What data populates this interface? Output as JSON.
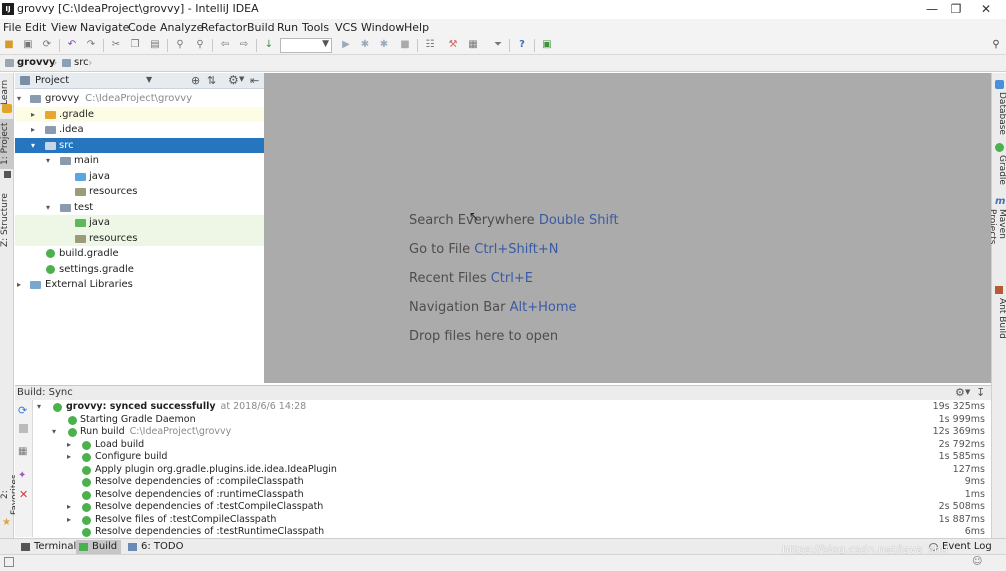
{
  "window": {
    "title": "grovvy [C:\\IdeaProject\\grovvy] - IntelliJ IDEA",
    "app_icon": "IJ",
    "controls": [
      "minimize-icon",
      "maximize-icon",
      "close-icon"
    ]
  },
  "menu": [
    "File",
    "Edit",
    "View",
    "Navigate",
    "Code",
    "Analyze",
    "Refactor",
    "Build",
    "Run",
    "Tools",
    "VCS",
    "Window",
    "Help"
  ],
  "breadcrumb": [
    "grovvy",
    "src"
  ],
  "left_stripe": [
    "1: Project",
    "Learn",
    "Z: Structure",
    "2: Favorites"
  ],
  "right_stripe": [
    "Database",
    "Gradle",
    "Maven Projects",
    "Ant Build"
  ],
  "project_panel": {
    "title": "Project",
    "tree": [
      {
        "label": "grovvy",
        "path": "C:\\IdeaProject\\grovvy",
        "arrow": "▾",
        "icon": "module-folder",
        "indent": 0
      },
      {
        "label": ".gradle",
        "arrow": "▸",
        "icon": "folder-orange",
        "indent": 1
      },
      {
        "label": ".idea",
        "arrow": "▸",
        "icon": "folder",
        "indent": 1
      },
      {
        "label": "src",
        "arrow": "▾",
        "icon": "folder",
        "indent": 1
      },
      {
        "label": "main",
        "arrow": "▾",
        "icon": "folder",
        "indent": 2
      },
      {
        "label": "java",
        "arrow": "",
        "icon": "folder-source",
        "indent": 3
      },
      {
        "label": "resources",
        "arrow": "",
        "icon": "folder-resources",
        "indent": 3
      },
      {
        "label": "test",
        "arrow": "▾",
        "icon": "folder",
        "indent": 2
      },
      {
        "label": "java",
        "arrow": "",
        "icon": "folder-test",
        "indent": 3
      },
      {
        "label": "resources",
        "arrow": "",
        "icon": "folder-resources",
        "indent": 3
      },
      {
        "label": "build.gradle",
        "arrow": "",
        "icon": "gradle-file",
        "indent": 2
      },
      {
        "label": "settings.gradle",
        "arrow": "",
        "icon": "gradle-file",
        "indent": 2
      },
      {
        "label": "External Libraries",
        "arrow": "▸",
        "icon": "library",
        "indent": 0
      }
    ]
  },
  "editor_hints": [
    {
      "text": "Search Everywhere",
      "key": "Double Shift"
    },
    {
      "text": "Go to File",
      "key": "Ctrl+Shift+N"
    },
    {
      "text": "Recent Files",
      "key": "Ctrl+E"
    },
    {
      "text": "Navigation Bar",
      "key": "Alt+Home"
    },
    {
      "text": "Drop files here to open",
      "key": ""
    }
  ],
  "build_panel": {
    "title": "Build: Sync",
    "rows": [
      {
        "arrow": "▾",
        "label": "grovvy: synced successfully",
        "sub": "at 2018/6/6 14:28",
        "time": "19s 325ms",
        "indent": 0,
        "bold": true
      },
      {
        "arrow": "",
        "label": "Starting Gradle Daemon",
        "sub": "",
        "time": "1s 999ms",
        "indent": 1
      },
      {
        "arrow": "▾",
        "label": "Run build",
        "sub": "C:\\IdeaProject\\grovvy",
        "time": "12s 369ms",
        "indent": 1
      },
      {
        "arrow": "▸",
        "label": "Load build",
        "sub": "",
        "time": "2s 792ms",
        "indent": 2
      },
      {
        "arrow": "▸",
        "label": "Configure build",
        "sub": "",
        "time": "1s 585ms",
        "indent": 2
      },
      {
        "arrow": "",
        "label": "Apply plugin org.gradle.plugins.ide.idea.IdeaPlugin",
        "sub": "",
        "time": "127ms",
        "indent": 2
      },
      {
        "arrow": "",
        "label": "Resolve dependencies of :compileClasspath",
        "sub": "",
        "time": "9ms",
        "indent": 2
      },
      {
        "arrow": "",
        "label": "Resolve dependencies of :runtimeClasspath",
        "sub": "",
        "time": "1ms",
        "indent": 2
      },
      {
        "arrow": "▸",
        "label": "Resolve dependencies of :testCompileClasspath",
        "sub": "",
        "time": "2s 508ms",
        "indent": 2
      },
      {
        "arrow": "▸",
        "label": "Resolve files of :testCompileClasspath",
        "sub": "",
        "time": "1s 887ms",
        "indent": 2
      },
      {
        "arrow": "",
        "label": "Resolve dependencies of :testRuntimeClasspath",
        "sub": "",
        "time": "6ms",
        "indent": 2
      }
    ]
  },
  "bottom_tabs": [
    {
      "label": "Terminal",
      "active": false
    },
    {
      "label": "Build",
      "active": true
    },
    {
      "label": "6: TODO",
      "active": false
    }
  ],
  "event_log": "Event Log",
  "watermark": "https://blog.csdn.net/java_shu",
  "colors": {
    "selection": "#2675bf",
    "editor_bg": "#ababab",
    "link_key": "#3a5aa6",
    "success_green": "#4cb04c"
  }
}
